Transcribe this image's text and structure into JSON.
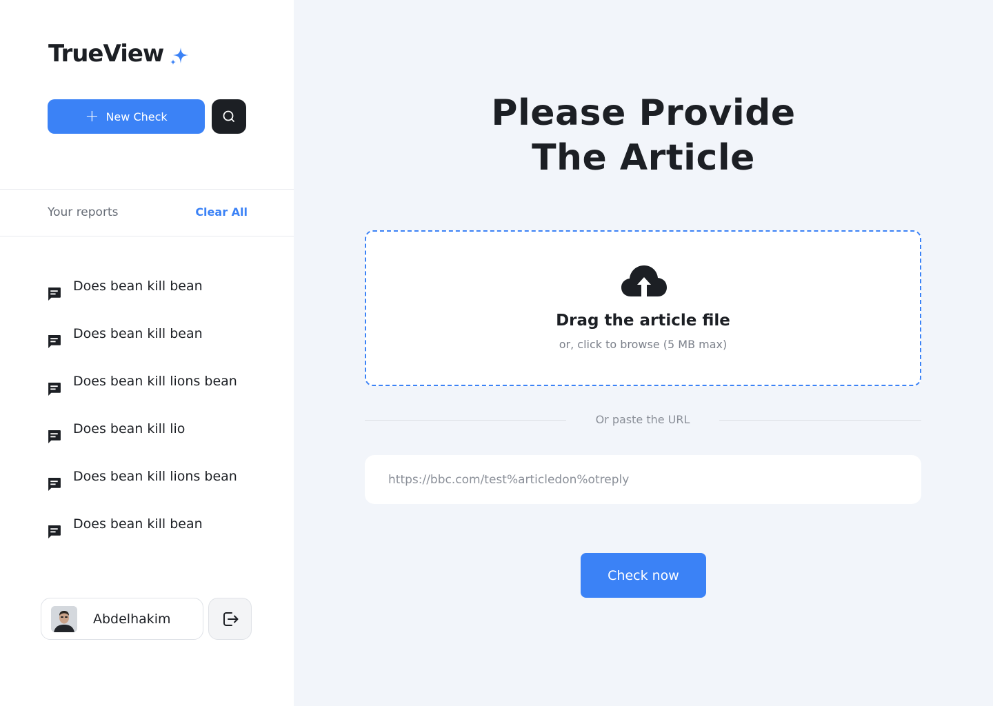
{
  "app": {
    "name": "TrueView",
    "accent_color": "#3b82f6"
  },
  "sidebar": {
    "new_check_label": "New Check",
    "search_icon": "search-icon",
    "reports_title": "Your reports",
    "clear_all_label": "Clear All",
    "reports": [
      {
        "label": "Does bean kill bean",
        "icon": "chat-icon"
      },
      {
        "label": "Does bean kill bean",
        "icon": "chat-icon"
      },
      {
        "label": "Does bean kill lions bean",
        "icon": "chat-icon"
      },
      {
        "label": "Does bean kill lio",
        "icon": "chat-icon"
      },
      {
        "label": "Does bean kill lions bean",
        "icon": "chat-icon"
      },
      {
        "label": "Does bean kill bean",
        "icon": "chat-icon"
      }
    ],
    "user": {
      "name": "Abdelhakim"
    },
    "logout_icon": "logout-icon"
  },
  "main": {
    "heading_line1": "Please Provide",
    "heading_line2": "The Article",
    "dropzone": {
      "icon": "cloud-upload-icon",
      "title": "Drag the article file",
      "subtitle": "or, click to browse (5 MB max)"
    },
    "or_text": "Or paste the URL",
    "url_input": {
      "value": "",
      "placeholder": "https://bbc.com/test%articledon%otreply"
    },
    "check_now_label": "Check now"
  }
}
